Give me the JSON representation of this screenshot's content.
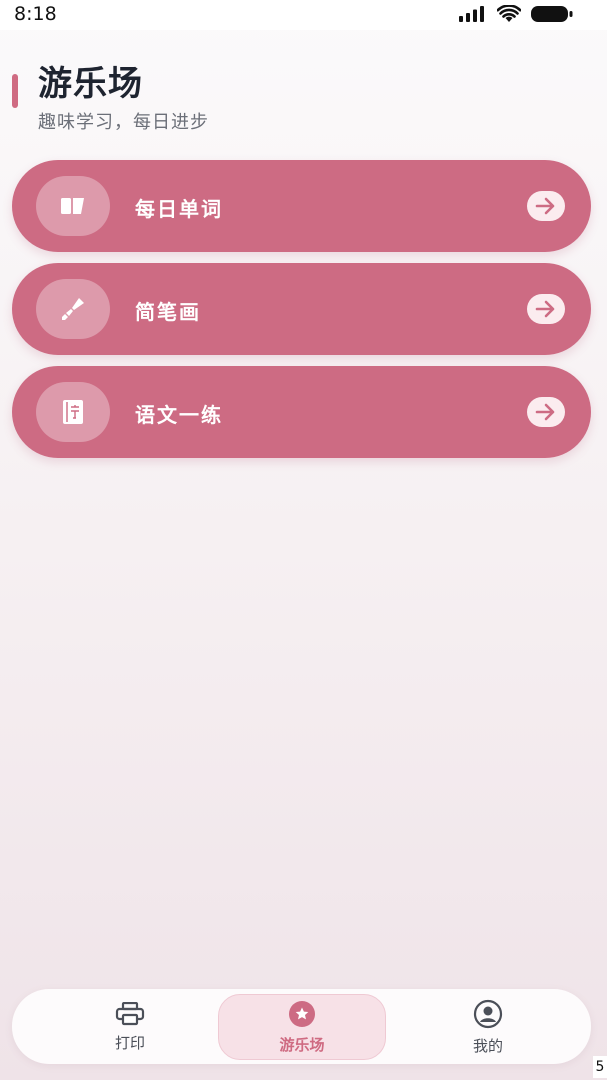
{
  "status_bar": {
    "time": "8:18",
    "icons": [
      "signal-icon",
      "wifi-icon",
      "battery-icon"
    ]
  },
  "header": {
    "title": "游乐场",
    "subtitle": "趣味学习，每日进步"
  },
  "cards": [
    {
      "label": "每日单词",
      "icon": "flashcards-icon"
    },
    {
      "label": "简笔画",
      "icon": "paintbrush-icon"
    },
    {
      "label": "语文一练",
      "icon": "character-book-icon"
    }
  ],
  "tab_bar": {
    "tabs": [
      {
        "label": "打印",
        "icon": "printer-icon",
        "active": false
      },
      {
        "label": "游乐场",
        "icon": "star-badge-icon",
        "active": true
      },
      {
        "label": "我的",
        "icon": "user-circle-icon",
        "active": false
      }
    ]
  },
  "corner_text": "5",
  "colors": {
    "accent": "#cd6b83",
    "tab_active_bg": "#f7e1e7",
    "title": "#1e2430"
  }
}
